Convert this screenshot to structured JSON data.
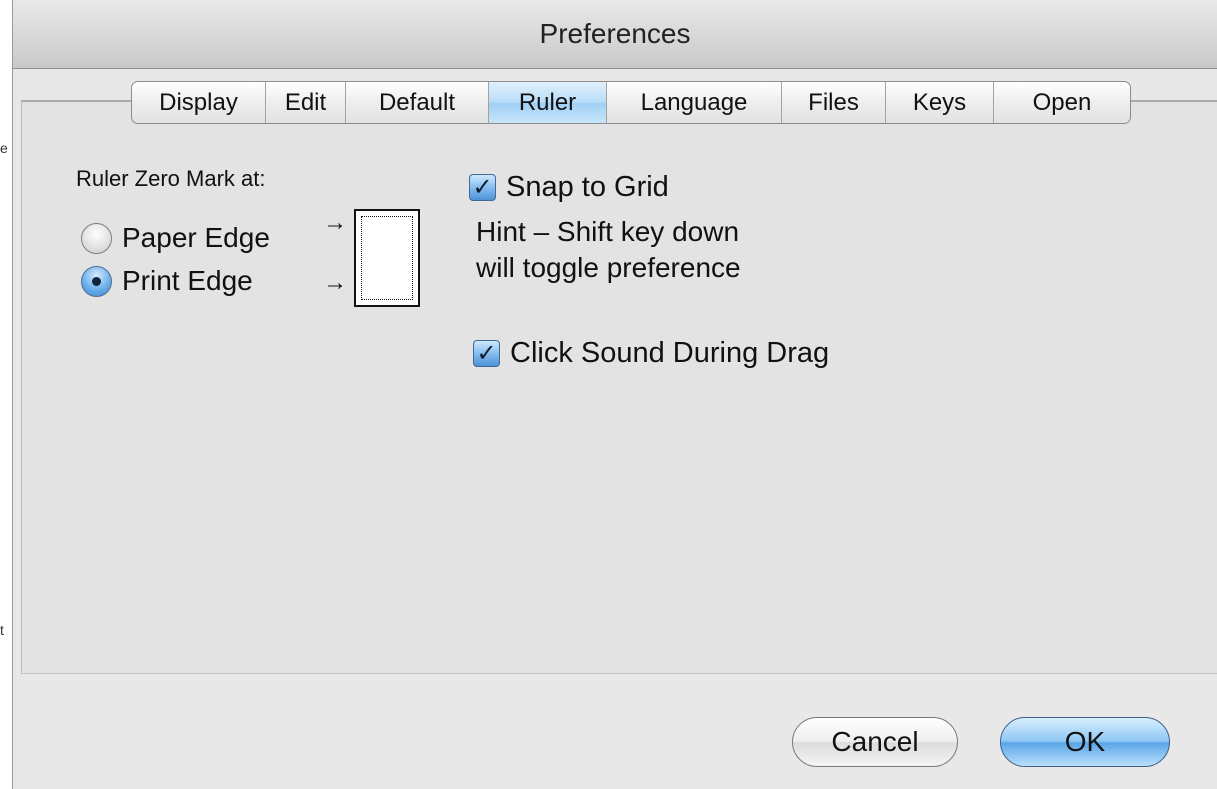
{
  "window": {
    "title": "Preferences"
  },
  "tabs": [
    {
      "label": "Display",
      "selected": false
    },
    {
      "label": "Edit",
      "selected": false
    },
    {
      "label": "Default",
      "selected": false
    },
    {
      "label": "Ruler",
      "selected": true
    },
    {
      "label": "Language",
      "selected": false
    },
    {
      "label": "Files",
      "selected": false
    },
    {
      "label": "Keys",
      "selected": false
    },
    {
      "label": "Open",
      "selected": false
    }
  ],
  "ruler": {
    "zero_mark_label": "Ruler Zero Mark at:",
    "options": [
      {
        "label": "Paper Edge",
        "checked": false
      },
      {
        "label": "Print Edge",
        "checked": true
      }
    ]
  },
  "snap": {
    "label": "Snap to Grid",
    "checked": true,
    "hint_line1": "Hint – Shift key down",
    "hint_line2": "will toggle preference"
  },
  "click_sound": {
    "label": "Click Sound During Drag",
    "checked": true
  },
  "buttons": {
    "cancel_label": "Cancel",
    "ok_label": "OK"
  },
  "colors": {
    "accent": "#5aa6e8",
    "selected_tab": "#b9dcf7",
    "window_bg": "#e8e8e8"
  },
  "icons": {
    "checkmark": "checkmark-icon",
    "arrow": "right-arrow-icon",
    "page": "page-diagram-icon"
  }
}
